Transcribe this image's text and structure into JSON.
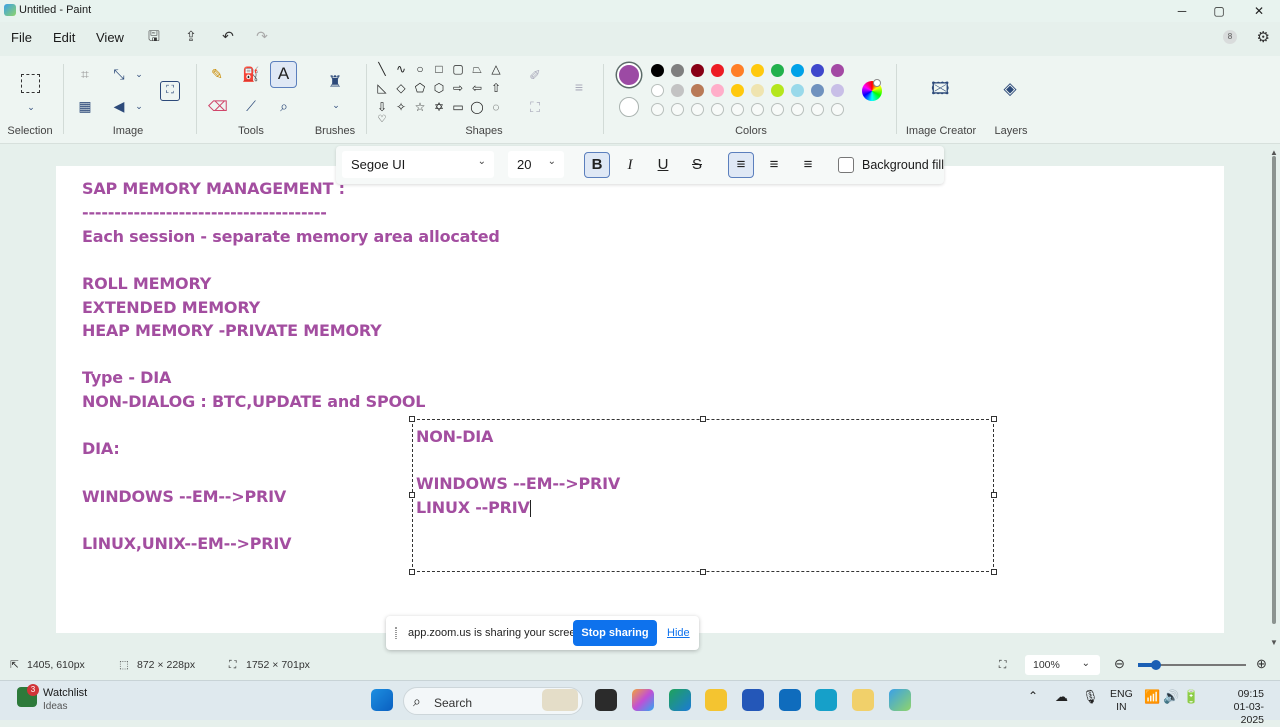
{
  "window": {
    "title": "Untitled - Paint",
    "minimize": "─",
    "maximize": "▢",
    "close": "✕"
  },
  "menu": {
    "items": [
      "File",
      "Edit",
      "View"
    ]
  },
  "account": {
    "avatar": "8"
  },
  "ribbon": {
    "groups": {
      "selection": "Selection",
      "image": "Image",
      "tools": "Tools",
      "brushes": "Brushes",
      "shapes": "Shapes",
      "colors": "Colors",
      "image_creator": "Image Creator",
      "layers": "Layers"
    },
    "text_tool_label": "A",
    "colors": {
      "primary": "#9c4aa4",
      "row1": [
        "#000000",
        "#7f7f7f",
        "#880015",
        "#ed1c24",
        "#ff7f27",
        "#ffc90e",
        "#22b14c",
        "#00a2e8",
        "#3f48cc",
        "#a349a4"
      ],
      "row2": [
        "#ffffff",
        "#c3c3c3",
        "#b97a57",
        "#ffaec9",
        "#ffc90e",
        "#efe4b0",
        "#b5e61d",
        "#99d9ea",
        "#7092be",
        "#c8bfe7"
      ]
    }
  },
  "text_toolbar": {
    "font": "Segoe UI",
    "size": "20",
    "bold": "B",
    "italic": "I",
    "underline": "U",
    "strike": "S",
    "background_fill": "Background fill"
  },
  "canvas_text": {
    "lines": [
      "SAP MEMORY MANAGEMENT :",
      "--------------------------------------",
      "Each session - separate memory area allocated",
      "ROLL MEMORY",
      "EXTENDED MEMORY",
      "HEAP MEMORY -PRIVATE MEMORY",
      "Type - DIA",
      "NON-DIALOG : BTC,UPDATE and SPOOL",
      "DIA:",
      "WINDOWS --EM-->PRIV",
      "LINUX,UNIX--EM-->PRIV"
    ],
    "textbox": [
      "NON-DIA",
      "WINDOWS --EM-->PRIV",
      "LINUX --PRIV"
    ]
  },
  "zoom_share": {
    "message": "app.zoom.us is sharing your screen.",
    "stop": "Stop sharing",
    "hide": "Hide"
  },
  "status": {
    "cursor": "1405, 610px",
    "selection": "872 × 228px",
    "canvas": "1752 × 701px",
    "zoom": "100%"
  },
  "taskbar": {
    "widget_title": "Watchlist",
    "widget_sub": "Ideas",
    "widget_badge": "3",
    "search": "Search",
    "lang1": "ENG",
    "lang2": "IN",
    "time": "09:15",
    "date": "01-03-2025"
  }
}
